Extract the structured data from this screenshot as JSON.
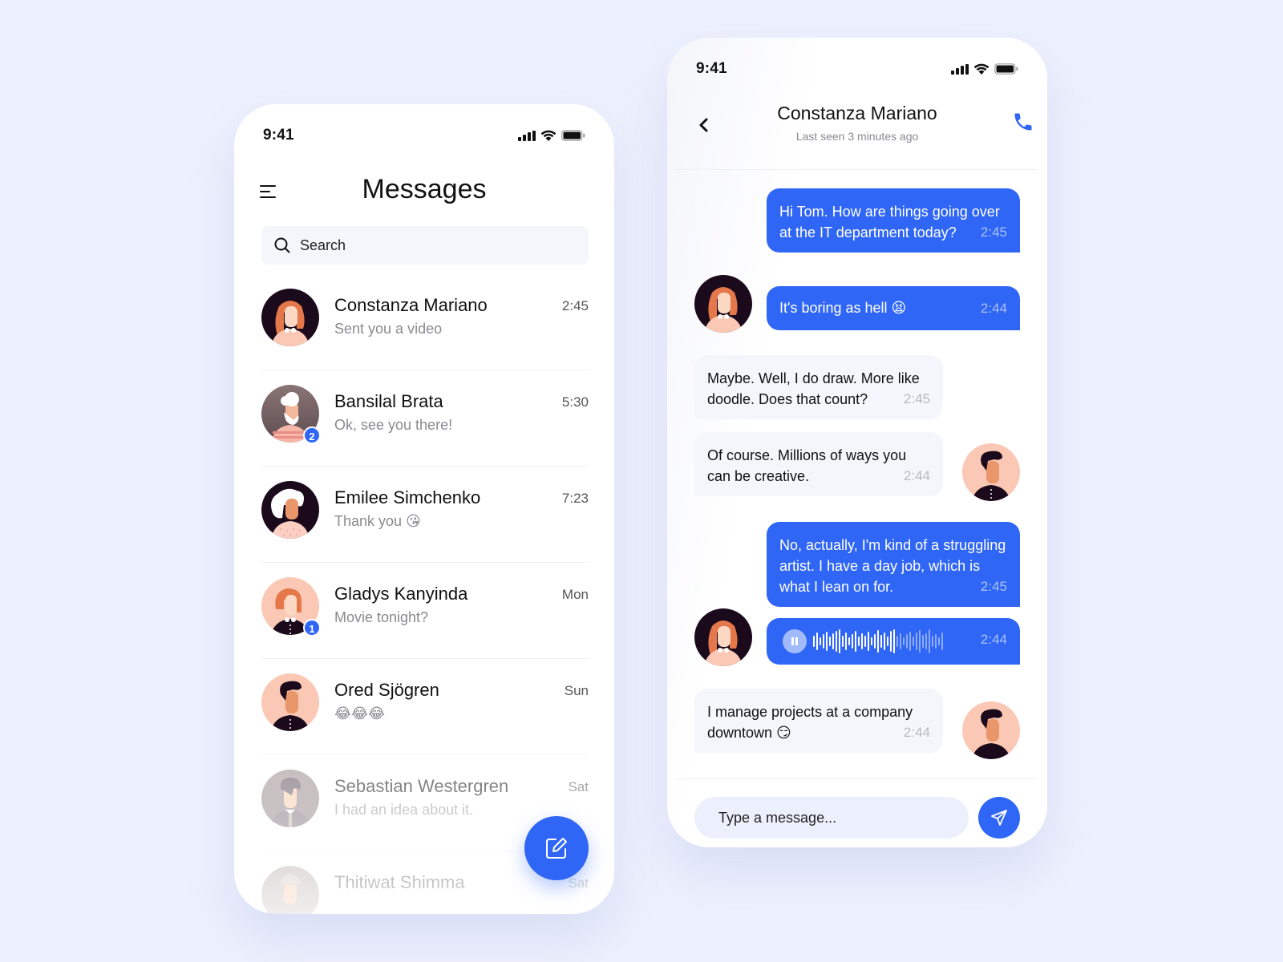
{
  "colors": {
    "accent": "#2F66F6",
    "background": "#EDF0FD",
    "incoming_bubble": "#F5F6FB"
  },
  "list_screen": {
    "status_time": "9:41",
    "title": "Messages",
    "search_placeholder": "Search",
    "conversations": [
      {
        "name": "Constanza Mariano",
        "preview": "Sent you a video",
        "time": "2:45",
        "badge": ""
      },
      {
        "name": "Bansilal Brata",
        "preview": "Ok, see you there!",
        "time": "5:30",
        "badge": "2"
      },
      {
        "name": "Emilee Simchenko",
        "preview": "Thank you  😘",
        "time": "7:23",
        "badge": ""
      },
      {
        "name": "Gladys Kanyinda",
        "preview": "Movie tonight?",
        "time": "Mon",
        "badge": "1"
      },
      {
        "name": "Ored Sjögren",
        "preview": "😂😂😂",
        "time": "Sun",
        "badge": ""
      },
      {
        "name": "Sebastian Westergren",
        "preview": "I had an idea about it.",
        "time": "Sat",
        "badge": ""
      },
      {
        "name": "Thitiwat Shimma",
        "preview": "",
        "time": "Sat",
        "badge": ""
      }
    ],
    "icons": {
      "menu": "hamburger-menu-icon",
      "search": "search-icon",
      "compose": "compose-edit-icon"
    }
  },
  "chat_screen": {
    "status_time": "9:41",
    "contact_name": "Constanza Mariano",
    "last_seen": "Last seen 3 minutes ago",
    "messages": [
      {
        "direction": "out",
        "text": "Hi Tom. How are things going over at the IT department today?",
        "time": "2:45"
      },
      {
        "direction": "out",
        "text": "It's boring as hell 😫",
        "time": "2:44"
      },
      {
        "direction": "in",
        "text": "Maybe. Well, I do draw. More like doodle. Does that count?",
        "time": "2:45"
      },
      {
        "direction": "in",
        "text": "Of course. Millions of ways you can be creative.",
        "time": "2:44"
      },
      {
        "direction": "out",
        "text": "No, actually, I'm kind of a struggling artist. I have a day job, which is what I lean on for.",
        "time": "2:45"
      },
      {
        "direction": "out",
        "type": "voice",
        "time": "2:44",
        "played_fraction": 0.62
      },
      {
        "direction": "in",
        "text": "I manage projects at a company downtown 😏",
        "time": "2:44"
      }
    ],
    "input_placeholder": "Type a message...",
    "icons": {
      "back": "chevron-left-icon",
      "call": "phone-icon",
      "send": "send-paper-plane-icon",
      "pause": "pause-icon"
    }
  }
}
